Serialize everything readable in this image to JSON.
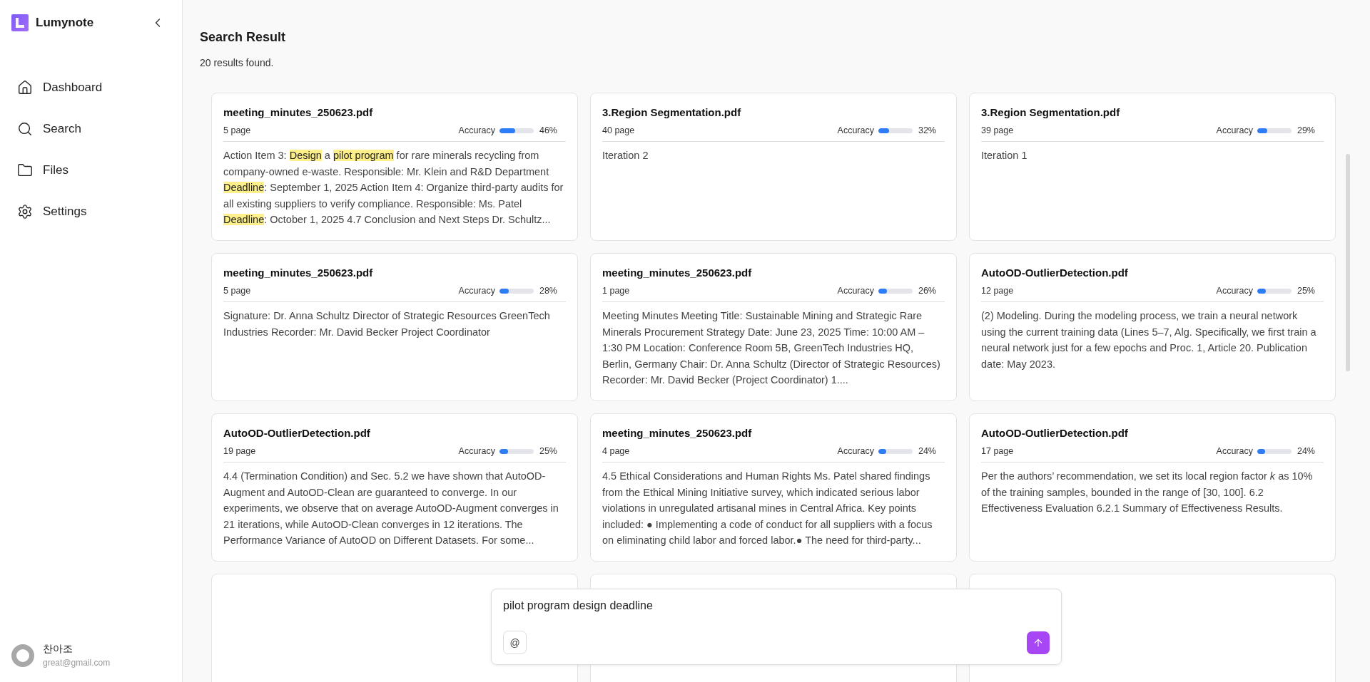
{
  "sidebar": {
    "app_name": "Lumynote",
    "items": [
      {
        "label": "Dashboard",
        "selected": false
      },
      {
        "label": "Search",
        "selected": false
      },
      {
        "label": "Files",
        "selected": false
      },
      {
        "label": "Settings",
        "selected": false
      }
    ],
    "user": {
      "name": "찬아조",
      "email": "great@gmail.com"
    }
  },
  "header": {
    "title": "Search Result",
    "count": "20 results found."
  },
  "results": [
    {
      "file": "meeting_minutes_250623.pdf",
      "pages": "5 page",
      "accuracy_label": "Accuracy",
      "level": 0.46,
      "percent": "46%",
      "snippet": [
        {
          "text": "Action Item 3: ",
          "highlighted": false
        },
        {
          "text": "Design",
          "highlighted": true
        },
        {
          "text": " a ",
          "highlighted": false
        },
        {
          "text": "pilot program",
          "highlighted": true
        },
        {
          "text": " for rare minerals recycling from company-owned e-waste. Responsible: Mr. Klein and R&D Department ",
          "highlighted": false
        },
        {
          "text": "Deadline",
          "highlighted": true
        },
        {
          "text": ": September 1, 2025 Action Item 4: Organize third-party audits for all existing suppliers to verify compliance. Responsible: Ms. Patel ",
          "highlighted": false
        },
        {
          "text": "Deadline",
          "highlighted": true
        },
        {
          "text": ": October 1, 2025 4.7 Conclusion and Next Steps Dr. Schultz...",
          "highlighted": false
        }
      ]
    },
    {
      "file": "3.Region Segmentation.pdf",
      "pages": "40 page",
      "accuracy_label": "Accuracy",
      "level": 0.32,
      "percent": "32%",
      "snippet": [
        {
          "text": "Iteration 2",
          "highlighted": false
        }
      ]
    },
    {
      "file": "3.Region Segmentation.pdf",
      "pages": "39 page",
      "accuracy_label": "Accuracy",
      "level": 0.29,
      "percent": "29%",
      "snippet": [
        {
          "text": "Iteration 1",
          "highlighted": false
        }
      ]
    },
    {
      "file": "meeting_minutes_250623.pdf",
      "pages": "5 page",
      "accuracy_label": "Accuracy",
      "level": 0.28,
      "percent": "28%",
      "snippet": [
        {
          "text": "Signature: Dr. Anna Schultz Director of Strategic Resources GreenTech Industries Recorder: Mr. David Becker Project Coordinator",
          "highlighted": false
        }
      ]
    },
    {
      "file": "meeting_minutes_250623.pdf",
      "pages": "1 page",
      "accuracy_label": "Accuracy",
      "level": 0.26,
      "percent": "26%",
      "snippet": [
        {
          "text": "Meeting Minutes Meeting Title: Sustainable Mining and Strategic Rare Minerals Procurement Strategy Date: June 23, 2025 Time: 10:00 AM – 1:30 PM Location: Conference Room 5B, GreenTech Industries HQ, Berlin, Germany Chair: Dr. Anna Schultz (Director of Strategic Resources) Recorder: Mr. David Becker (Project Coordinator) 1....",
          "highlighted": false
        }
      ]
    },
    {
      "file": "AutoOD-OutlierDetection.pdf",
      "pages": "12 page",
      "accuracy_label": "Accuracy",
      "level": 0.25,
      "percent": "25%",
      "snippet": [
        {
          "text": "(2) Modeling. During the modeling process, we train a neural network using the current training data (Lines 5–7, Alg. Specifically, we first train a neural network just for a few epochs and Proc. 1, Article 20. Publication date: May 2023.",
          "highlighted": false
        }
      ]
    },
    {
      "file": "AutoOD-OutlierDetection.pdf",
      "pages": "19 page",
      "accuracy_label": "Accuracy",
      "level": 0.25,
      "percent": "25%",
      "snippet": [
        {
          "text": "4.4 (Termination Condition) and Sec. 5.2 we have shown that AutoOD-Augment and AutoOD-Clean are guaranteed to converge. In our experiments, we observe that on average AutoOD-Augment converges in 21 iterations, while AutoOD-Clean converges in 12 iterations. The Performance Variance of AutoOD on Different Datasets. For some...",
          "highlighted": false
        }
      ]
    },
    {
      "file": "meeting_minutes_250623.pdf",
      "pages": "4 page",
      "accuracy_label": "Accuracy",
      "level": 0.24,
      "percent": "24%",
      "snippet": [
        {
          "text": "4.5 Ethical Considerations and Human Rights Ms. Patel shared findings from the Ethical Mining Initiative survey, which indicated serious labor violations in unregulated artisanal mines in Central Africa. Key points included: ● Implementing a code of conduct for all suppliers with a focus on eliminating child labor and forced labor.● The need for third-party...",
          "highlighted": false
        }
      ]
    },
    {
      "file": "AutoOD-OutlierDetection.pdf",
      "pages": "17 page",
      "accuracy_label": "Accuracy",
      "level": 0.24,
      "percent": "24%",
      "snippet": [
        {
          "text": "Per the authors’ recommendation, we set its local region factor *k* as 10% of the training samples, bounded in the range of [30, 100]. 6.2 Effectiveness Evaluation 6.2.1 Summary of Effectiveness Results.",
          "highlighted": false
        }
      ]
    }
  ],
  "query": {
    "value": "pilot program design deadline",
    "mention_symbol": "@"
  }
}
